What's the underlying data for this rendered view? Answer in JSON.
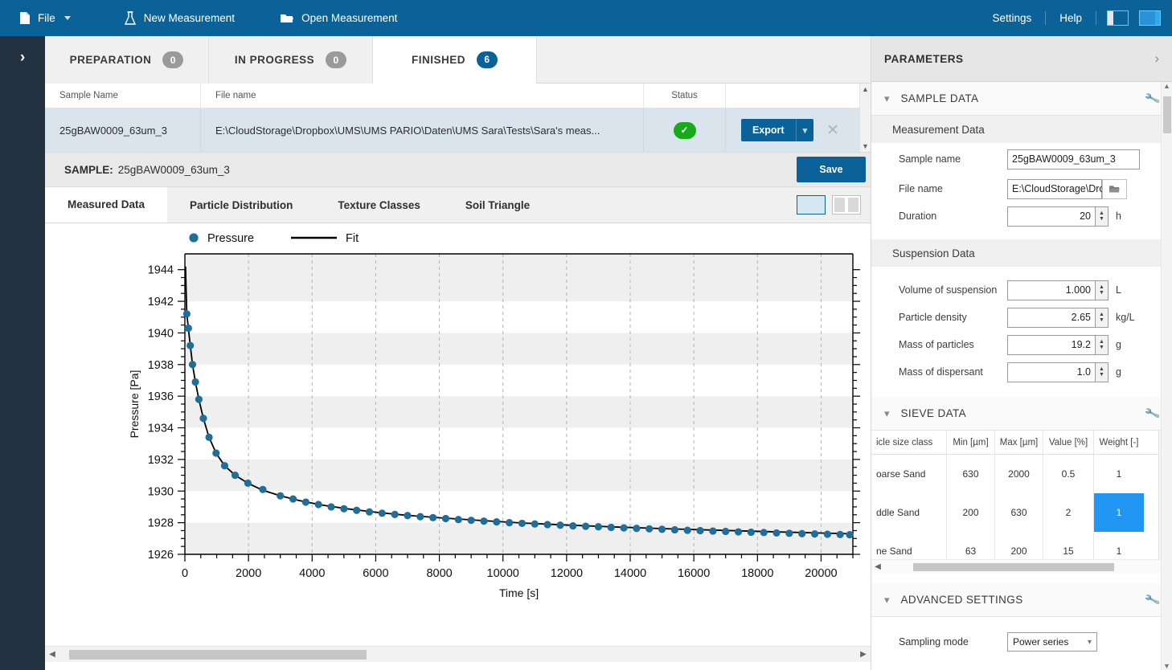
{
  "topbar": {
    "file": "File",
    "new_measurement": "New Measurement",
    "open_measurement": "Open Measurement",
    "settings": "Settings",
    "help": "Help",
    "brand_blue": "#0b6298"
  },
  "status_tabs": [
    {
      "label": "PREPARATION",
      "count": "0",
      "active": false
    },
    {
      "label": "IN PROGRESS",
      "count": "0",
      "active": false
    },
    {
      "label": "FINISHED",
      "count": "6",
      "active": true
    }
  ],
  "measurement_list": {
    "headers": {
      "sample_name": "Sample Name",
      "file_name": "File name",
      "status": "Status",
      "actions": ""
    },
    "rows": [
      {
        "sample_name": "25gBAW0009_63um_3",
        "file_name": "E:\\CloudStorage\\Dropbox\\UMS\\UMS PARIO\\Daten\\UMS Sara\\Tests\\Sara's meas...",
        "status_icon": "check-icon",
        "export_label": "Export",
        "close_icon": "close-icon"
      }
    ]
  },
  "sample_bar": {
    "label": "SAMPLE:",
    "value": "25gBAW0009_63um_3",
    "save_label": "Save"
  },
  "data_tabs": [
    {
      "label": "Measured Data",
      "active": true
    },
    {
      "label": "Particle Distribution",
      "active": false
    },
    {
      "label": "Texture Classes",
      "active": false
    },
    {
      "label": "Soil Triangle",
      "active": false
    }
  ],
  "chart_data": {
    "type": "scatter",
    "title": "",
    "xlabel": "Time [s]",
    "ylabel": "Pressure [Pa]",
    "xlim": [
      0,
      21000
    ],
    "ylim": [
      1926,
      1945
    ],
    "xticks": [
      0,
      2000,
      4000,
      6000,
      8000,
      10000,
      12000,
      14000,
      16000,
      18000,
      20000
    ],
    "yticks": [
      1926,
      1928,
      1930,
      1932,
      1934,
      1936,
      1938,
      1940,
      1942,
      1944
    ],
    "grid": "dashed-vertical-with-horizontal-bands",
    "legend_position": "top-left",
    "marker_color": "#1f6f9a",
    "line_color": "#000000",
    "series": [
      {
        "name": "Pressure",
        "kind": "scatter",
        "x": [
          60,
          110,
          170,
          240,
          330,
          440,
          580,
          760,
          980,
          1250,
          1580,
          1980,
          2450,
          3000,
          3400,
          3800,
          4200,
          4600,
          5000,
          5400,
          5800,
          6200,
          6600,
          7000,
          7400,
          7800,
          8200,
          8600,
          9000,
          9400,
          9800,
          10200,
          10600,
          11000,
          11400,
          11800,
          12200,
          12600,
          13000,
          13400,
          13800,
          14200,
          14600,
          15000,
          15400,
          15800,
          16200,
          16600,
          17000,
          17400,
          17800,
          18200,
          18600,
          19000,
          19400,
          19800,
          20200,
          20600,
          20900
        ],
        "y": [
          1941.2,
          1940.3,
          1939.2,
          1938.0,
          1936.9,
          1935.8,
          1934.6,
          1933.4,
          1932.4,
          1931.6,
          1931.0,
          1930.5,
          1930.1,
          1929.7,
          1929.5,
          1929.3,
          1929.15,
          1929.0,
          1928.88,
          1928.78,
          1928.68,
          1928.6,
          1928.52,
          1928.45,
          1928.38,
          1928.32,
          1928.26,
          1928.2,
          1928.15,
          1928.1,
          1928.05,
          1928.0,
          1927.96,
          1927.92,
          1927.88,
          1927.84,
          1927.8,
          1927.77,
          1927.74,
          1927.7,
          1927.67,
          1927.64,
          1927.61,
          1927.58,
          1927.55,
          1927.52,
          1927.5,
          1927.47,
          1927.45,
          1927.42,
          1927.4,
          1927.38,
          1927.35,
          1927.33,
          1927.31,
          1927.29,
          1927.27,
          1927.25,
          1927.24
        ]
      },
      {
        "name": "Fit",
        "kind": "line",
        "x": [
          20,
          60,
          110,
          170,
          240,
          330,
          440,
          580,
          760,
          980,
          1250,
          1580,
          1980,
          2450,
          3000,
          3600,
          4300,
          5100,
          6000,
          7000,
          8100,
          9300,
          10600,
          12000,
          13500,
          15100,
          16800,
          18600,
          20900
        ],
        "y": [
          1944.2,
          1941.2,
          1940.3,
          1939.2,
          1938.0,
          1936.9,
          1935.8,
          1934.6,
          1933.4,
          1932.4,
          1931.6,
          1931.0,
          1930.5,
          1930.05,
          1929.7,
          1929.4,
          1929.12,
          1928.88,
          1928.66,
          1928.46,
          1928.3,
          1928.14,
          1927.98,
          1927.85,
          1927.73,
          1927.62,
          1927.52,
          1927.42,
          1927.3
        ]
      }
    ],
    "legend": [
      {
        "name": "Pressure",
        "marker": "circle",
        "color": "#1f6f9a"
      },
      {
        "name": "Fit",
        "marker": "line",
        "color": "#000000"
      }
    ]
  },
  "parameters": {
    "title": "PARAMETERS",
    "sections": {
      "sample_data": {
        "title": "SAMPLE DATA",
        "measurement_data_label": "Measurement Data",
        "fields": [
          {
            "label": "Sample name",
            "value": "25gBAW0009_63um_3",
            "unit": ""
          },
          {
            "label": "File name",
            "value": "E:\\CloudStorage\\Dro",
            "unit": ""
          },
          {
            "label": "Duration",
            "value": "20",
            "unit": "h"
          }
        ],
        "suspension_data_label": "Suspension Data",
        "suspension_fields": [
          {
            "label": "Volume of suspension",
            "value": "1.000",
            "unit": "L"
          },
          {
            "label": "Particle density",
            "value": "2.65",
            "unit": "kg/L"
          },
          {
            "label": "Mass of particles",
            "value": "19.2",
            "unit": "g"
          },
          {
            "label": "Mass of dispersant",
            "value": "1.0",
            "unit": "g"
          }
        ]
      },
      "sieve_data": {
        "title": "SIEVE DATA",
        "headers": [
          "icle size class",
          "Min [µm]",
          "Max [µm]",
          "Value [%]",
          "Weight [-]"
        ],
        "rows": [
          {
            "cls": "oarse Sand",
            "min": "630",
            "max": "2000",
            "value": "0.5",
            "weight": "1",
            "selected": false
          },
          {
            "cls": "ddle Sand",
            "min": "200",
            "max": "630",
            "value": "2",
            "weight": "1",
            "selected": true
          },
          {
            "cls": "ne Sand",
            "min": "63",
            "max": "200",
            "value": "15",
            "weight": "1",
            "selected": false
          }
        ]
      },
      "advanced_settings": {
        "title": "ADVANCED SETTINGS",
        "fields": [
          {
            "label": "Sampling mode",
            "value": "Power series"
          }
        ]
      }
    }
  }
}
